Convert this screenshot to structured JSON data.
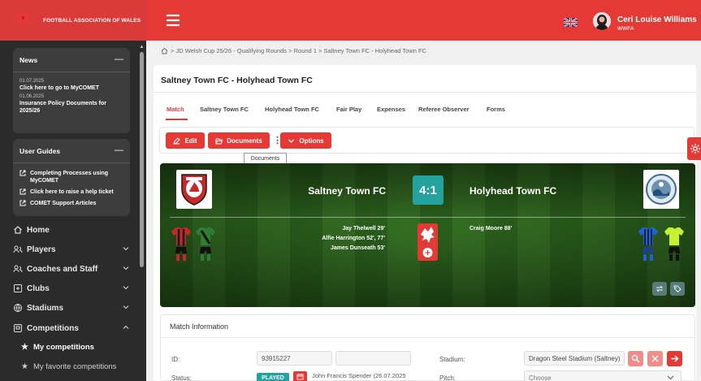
{
  "brand": {
    "name": "FOOTBALL ASSOCIATION OF WALES"
  },
  "sidebar": {
    "news": {
      "title": "News",
      "items": [
        {
          "date": "01.07.2025",
          "text": "Click here to go to MyCOMET"
        },
        {
          "date": "01.06.2025",
          "text": "Insurance Policy Documents for 2025/26"
        }
      ]
    },
    "guides": {
      "title": "User Guides",
      "items": [
        {
          "text": "Completing Processes using MyCOMET"
        },
        {
          "text": "Click here to raise a help ticket"
        },
        {
          "text": "COMET Support Articles"
        }
      ]
    },
    "nav": {
      "home": "Home",
      "players": "Players",
      "coaches": "Coaches and Staff",
      "clubs": "Clubs",
      "stadiums": "Stadiums",
      "competitions": "Competitions"
    },
    "sub": {
      "my_competitions": "My competitions",
      "my_favorite": "My favorite competitions"
    }
  },
  "topbar": {
    "user_name": "Ceri Louise Williams",
    "user_org": "WWFA"
  },
  "breadcrumb": "> JD Welsh Cup 25/26 - Qualifying Rounds > Round 1 > Saltney Town FC - Holyhead Town FC",
  "page_title": "Saltney Town FC - Holyhead Town FC",
  "tabs": [
    "Match",
    "Saltney Town FC",
    "Holyhead Town FC",
    "Fair Play",
    "Expenses",
    "Referee Observer",
    "Forms"
  ],
  "toolbar": {
    "edit": "Edit",
    "documents": "Documents",
    "options": "Options",
    "tooltip": "Documents"
  },
  "match": {
    "home_team": "Saltney Town FC",
    "away_team": "Holyhead Town FC",
    "score": "4:1",
    "home_scorers": [
      "Jay Thelwell 29'",
      "Alfie Harrington 52', 77'",
      "James Dunseath 53'"
    ],
    "away_scorers": [
      "Craig Moore 88'"
    ],
    "colors": {
      "score_bg": "#24a29d",
      "home_kit": [
        "#c62828",
        "#1a1a1a"
      ],
      "home_keeper": "#2e7d32",
      "away_kit": [
        "#1e63d6",
        "#111111"
      ],
      "away_keeper": "#c6f032"
    }
  },
  "info": {
    "title": "Match Information",
    "id_label": "ID:",
    "id_value": "93915227",
    "status_label": "Status:",
    "status_value": "PLAYED",
    "played_by": "John Francis Spender (26.07.2025",
    "stadium_label": "Stadium:",
    "stadium_value": "Dragon Steel Stadium (Saltney)",
    "pitch_label": "Pitch:",
    "pitch_placeholder": "Choose"
  },
  "theme": {
    "accent": "#e53935",
    "sidebar_bg": "#2b2b2b",
    "card_bg": "#3d3d3d"
  }
}
